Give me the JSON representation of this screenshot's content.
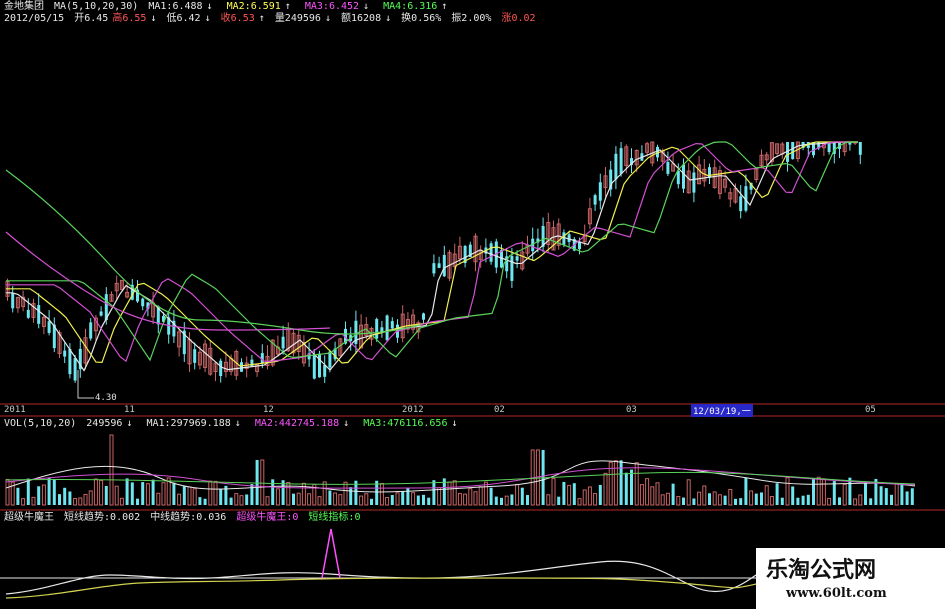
{
  "header": {
    "name": "金地集团",
    "ma_label": "MA(5,10,20,30)",
    "ma1": "MA1:6.488",
    "ma2": "MA2:6.591",
    "ma3": "MA3:6.452",
    "ma4": "MA4:6.316",
    "date": "2012/05/15",
    "open": "开6.45",
    "high": "高6.55",
    "low": "低6.42",
    "close": "收6.53",
    "vol": "量249596",
    "amount": "额16208",
    "turnover": "换0.56%",
    "amplitude": "振2.00%",
    "change": "涨0.02"
  },
  "low_marker": "4.30",
  "date_axis": [
    "2011",
    "11",
    "12",
    "2012",
    "02",
    "03",
    "12/03/19,一",
    "05"
  ],
  "volume": {
    "label": "VOL(5,10,20)",
    "value": "249596",
    "ma1": "MA1:297969.188",
    "ma2": "MA2:442745.188",
    "ma3": "MA3:476116.656"
  },
  "indicator": {
    "name": "超级牛魔王",
    "short": "短线趋势:0.002",
    "mid": "中线趋势:0.036",
    "magic": "超级牛魔王:0",
    "short_index": "短线指标:0"
  },
  "watermark": {
    "title": "乐淘公式网",
    "url": "www.60lt.com"
  },
  "arrows": {
    "down": "↓",
    "up": "↑"
  },
  "colors": {
    "up_candle": "#c86464",
    "down_candle": "#6ee6f0",
    "ma_white": "#e8e8e8",
    "ma_yellow": "#f0f050",
    "ma_magenta": "#d250d2",
    "ma_green": "#5ad25a",
    "divider": "#b42828"
  }
}
